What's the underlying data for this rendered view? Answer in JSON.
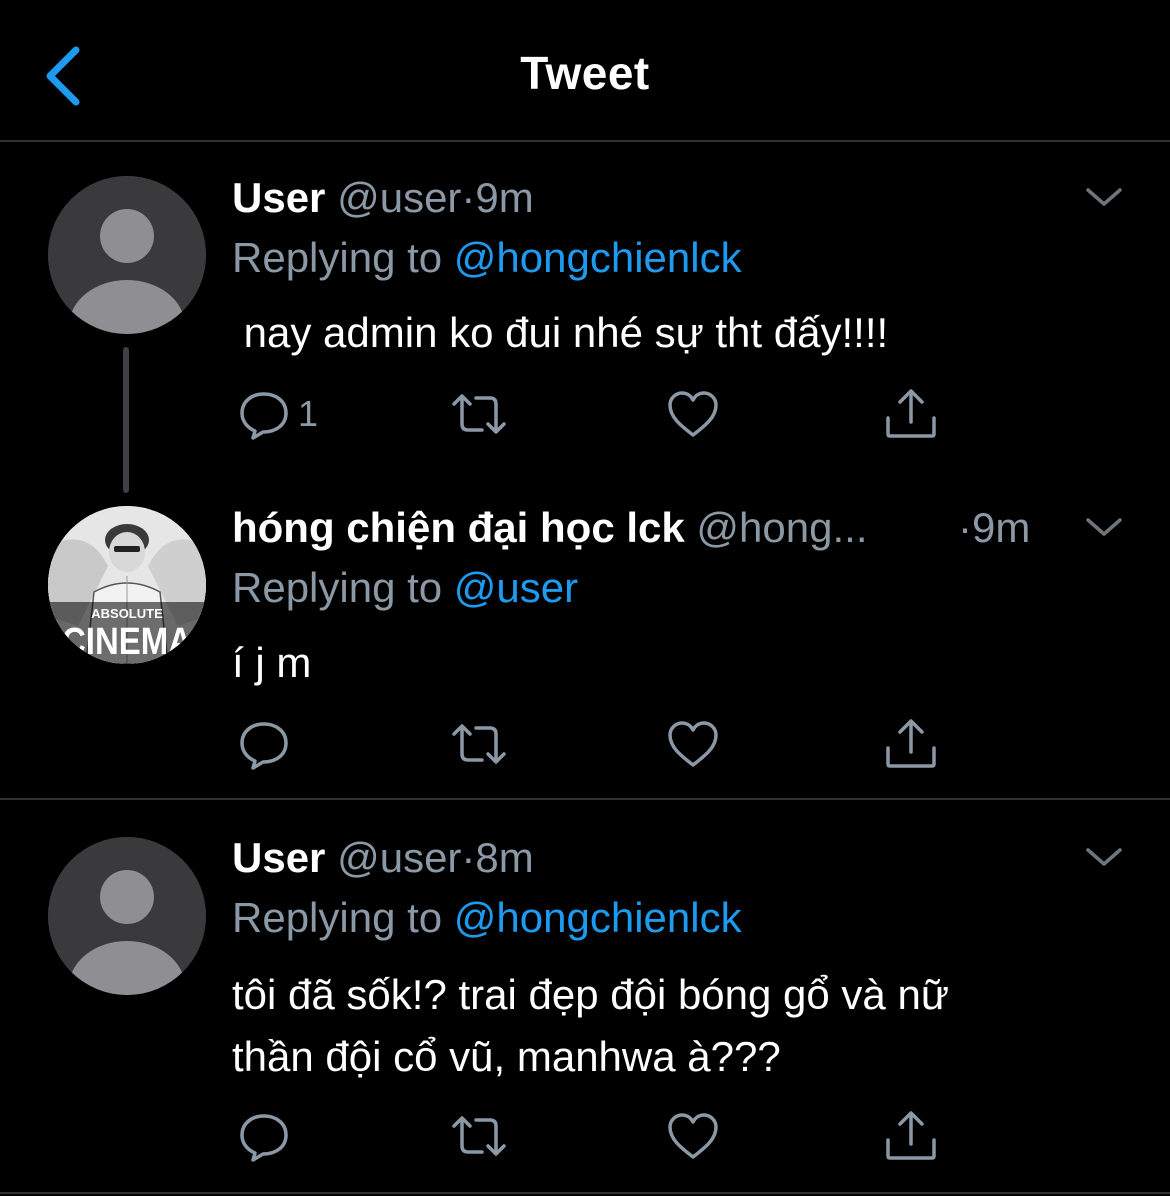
{
  "header": {
    "title": "Tweet",
    "back_icon": "chevron-left-icon",
    "accent_color": "#1d9bf0"
  },
  "tweets": [
    {
      "name": "User",
      "handle": "@user",
      "time": "9m",
      "replying_prefix": "Replying to",
      "replying_to": "@hongchienlck",
      "text": " nay admin ko đui nhé sự tht đấy!!!!",
      "reply_count": "1"
    },
    {
      "name": "hóng chiện đại học lck",
      "handle": "@hong...",
      "time": "9m",
      "replying_prefix": "Replying to",
      "replying_to": "@user",
      "text": "í j m",
      "reply_count": "",
      "avatar_text_top": "ABSOLUTE",
      "avatar_text_bottom": "CINEMA"
    },
    {
      "name": "User",
      "handle": "@user",
      "time": "8m",
      "replying_prefix": "Replying to",
      "replying_to": "@hongchienlck",
      "text": "tôi đã sốk!? trai đẹp đội bóng gổ và nữ\nthần đội cổ vũ, manhwa à???",
      "reply_count": ""
    }
  ],
  "separator": "·",
  "icons": {
    "reply": "reply-icon",
    "retweet": "retweet-icon",
    "like": "heart-icon",
    "share": "share-icon",
    "more": "chevron-down-icon"
  }
}
